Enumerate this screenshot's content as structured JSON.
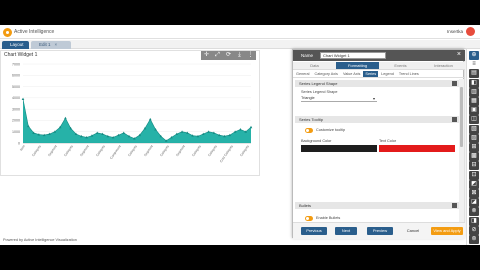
{
  "app": {
    "title": "Active Intelligence",
    "user": "Insertka",
    "footer": "Powered by Active Intelligence Visualization"
  },
  "tabs": [
    {
      "label": "Layout 1",
      "close": "×"
    },
    {
      "label": "Edit 1",
      "close": "×"
    }
  ],
  "widget": {
    "title": "Chart Widget 1",
    "tool_icons": [
      "✛",
      "⤢",
      "⟳",
      "⤓",
      "⋮"
    ]
  },
  "chart_data": {
    "type": "area",
    "categories": [
      "Item",
      "Category",
      "Category",
      "Category",
      "Category",
      "Category",
      "Category",
      "Category",
      "Category",
      "Category",
      "Category",
      "Category",
      "Category",
      "Category",
      "Category",
      "Category",
      "Category",
      "Category",
      "Category",
      "Category",
      "Category",
      "Category",
      "Category",
      "Category",
      "Category",
      "Category",
      "Category",
      "Category",
      "Category",
      "Category",
      "Category",
      "Category",
      "Category",
      "Category",
      "Category",
      "Category",
      "Category",
      "Category",
      "Category",
      "Category",
      "Category",
      "Category",
      "Category",
      "Category"
    ],
    "x_tick_labels": [
      "Item",
      "Category",
      "Segment",
      "Category",
      "Segment",
      "Category",
      "Component",
      "Category",
      "Segment",
      "Category",
      "Segment",
      "Category",
      "Category",
      "Cost Category",
      "Category"
    ],
    "values": [
      3900,
      1500,
      900,
      750,
      700,
      800,
      1000,
      1400,
      2200,
      1300,
      800,
      600,
      500,
      650,
      900,
      800,
      600,
      500,
      700,
      900,
      600,
      400,
      700,
      1300,
      2100,
      1200,
      600,
      200,
      500,
      800,
      1000,
      900,
      650,
      600,
      800,
      1000,
      900,
      700,
      600,
      700,
      1000,
      1200,
      1000,
      1400
    ],
    "y_ticks": [
      "7000",
      "6000",
      "5000",
      "4000",
      "3000",
      "2000",
      "1000",
      "0"
    ],
    "ylim": [
      0,
      7000
    ],
    "fill_color": "#1aaea3",
    "line_color": "#138a82"
  },
  "panel": {
    "name_label": "Name",
    "name_value": "Chart Widget 1",
    "close": "×",
    "tabs": [
      "Data",
      "Formatting",
      "Events",
      "Interaction"
    ],
    "active_tab": 1,
    "subtabs": [
      "General",
      "Category Axis",
      "Value Axis",
      "Series",
      "Legend",
      "Trend Lines"
    ],
    "active_subtab": 3,
    "sections": {
      "legend_shape": {
        "header": "Series Legend Shape",
        "field_label": "Series Legend Shape",
        "field_value": "Triangle"
      },
      "series_tooltip": {
        "header": "Series Tooltip",
        "toggle_label": "Customize tooltip",
        "bg_label": "Background Color",
        "text_label": "Text Color",
        "bg_color": "#1e1e1e",
        "text_color": "#e31b1b"
      },
      "bullets": {
        "header": "Bullets",
        "toggle_label": "Enable Bullets",
        "type_label": "Type",
        "type_value": "Square",
        "radius_label": "Radius",
        "radius_value": "10"
      }
    },
    "buttons": {
      "previous": "Previous",
      "next": "Next",
      "preview": "Preview",
      "cancel": "Cancel",
      "apply": "View and Apply"
    }
  },
  "rightbar_icons": [
    "⊕",
    "≡",
    "▤",
    "◧",
    "▥",
    "▦",
    "▣",
    "◫",
    "▧",
    "▨",
    "⊞",
    "▩",
    "⊟",
    "⊡",
    "◩",
    "⊠",
    "◪",
    "⊗",
    "◨",
    "⊘",
    "⊚"
  ]
}
